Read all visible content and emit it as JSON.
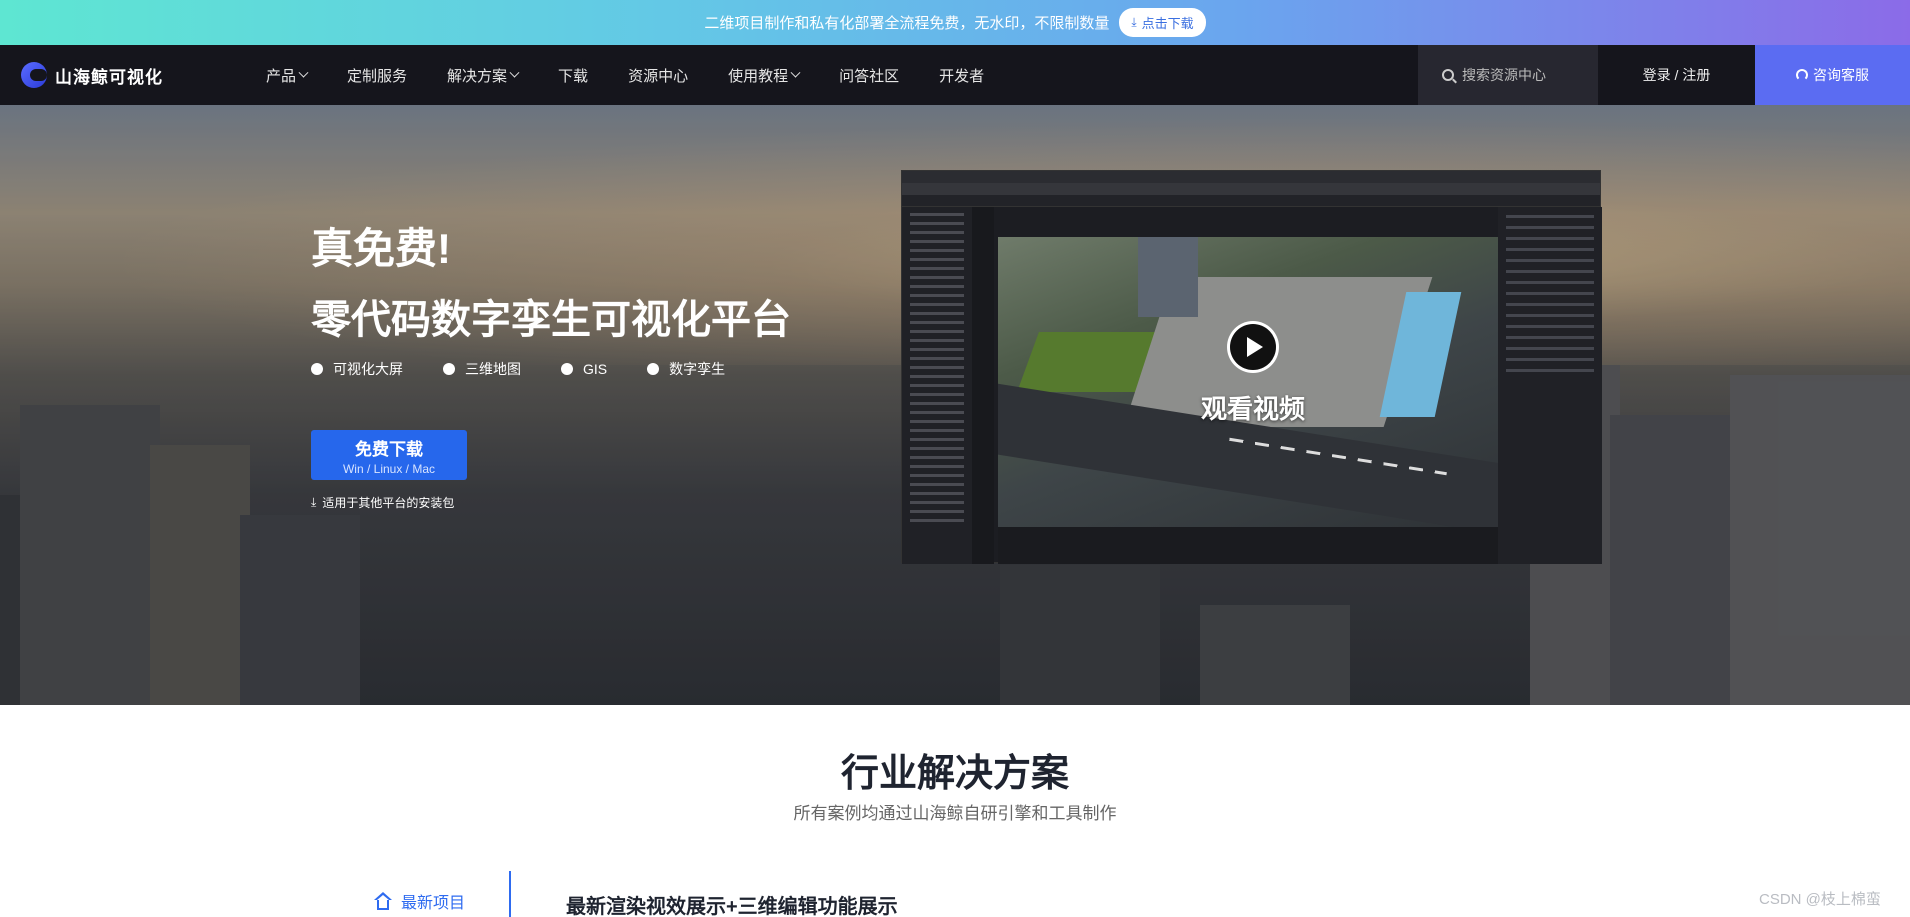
{
  "promo": {
    "text": "二维项目制作和私有化部署全流程免费，无水印，不限制数量",
    "button": "点击下载",
    "button_icon": "download-icon"
  },
  "nav": {
    "logo": "山海鲸可视化",
    "menu": [
      {
        "label": "产品",
        "dropdown": true
      },
      {
        "label": "定制服务",
        "dropdown": false
      },
      {
        "label": "解决方案",
        "dropdown": true
      },
      {
        "label": "下载",
        "dropdown": false
      },
      {
        "label": "资源中心",
        "dropdown": false
      },
      {
        "label": "使用教程",
        "dropdown": true
      },
      {
        "label": "问答社区",
        "dropdown": false
      },
      {
        "label": "开发者",
        "dropdown": false
      }
    ],
    "search_placeholder": "搜索资源中心",
    "login": "登录 / 注册",
    "consult": "咨询客服"
  },
  "hero": {
    "title1": "真免费!",
    "title2": "零代码数字孪生可视化平台",
    "tags": [
      "可视化大屏",
      "三维地图",
      "GIS",
      "数字孪生"
    ],
    "download_main": "免费下载",
    "download_sub": "Win / Linux / Mac",
    "other_platforms": "适用于其他平台的安装包",
    "watch_video": "观看视频"
  },
  "solutions": {
    "title": "行业解决方案",
    "subtitle": "所有案例均通过山海鲸自研引擎和工具制作",
    "tab_latest": "最新项目",
    "latest_title": "最新渲染视效展示+三维编辑功能展示"
  },
  "watermark": "CSDN @枝上棉蛮",
  "colors": {
    "accent": "#2e6bf0",
    "nav_bg": "#15151c",
    "consult_bg": "#5b6cf2",
    "download_btn": "#2667ec"
  }
}
